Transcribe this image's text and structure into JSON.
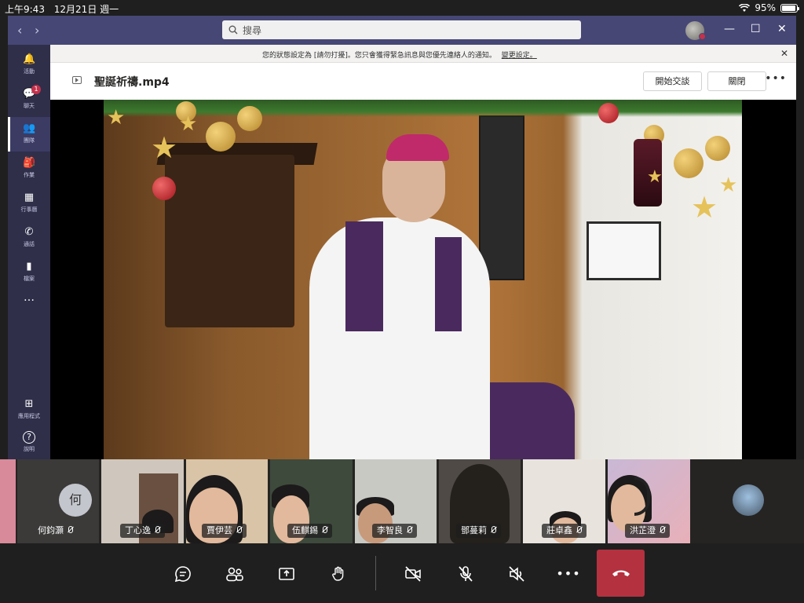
{
  "status_bar": {
    "time": "上午9:43",
    "date": "12月21日 週一",
    "battery": "95%",
    "battery_level": 0.95
  },
  "titlebar": {
    "search_placeholder": "搜尋",
    "back": "‹",
    "forward": "›",
    "minimize": "—",
    "maximize": "☐",
    "close": "✕"
  },
  "rail": {
    "items": [
      {
        "label": "活動",
        "icon": "bell-icon",
        "glyph": "🔔"
      },
      {
        "label": "聊天",
        "icon": "chat-icon",
        "glyph": "💬",
        "badge": "1"
      },
      {
        "label": "團隊",
        "icon": "teams-icon",
        "glyph": "👥",
        "active": true
      },
      {
        "label": "作業",
        "icon": "assignments-icon",
        "glyph": "🎒"
      },
      {
        "label": "行事曆",
        "icon": "calendar-icon",
        "glyph": "▦"
      },
      {
        "label": "通話",
        "icon": "phone-icon",
        "glyph": "✆"
      },
      {
        "label": "檔案",
        "icon": "file-icon",
        "glyph": "▮"
      },
      {
        "label": "…",
        "icon": "more-icon"
      }
    ],
    "bottom": [
      {
        "label": "應用程式",
        "icon": "apps-icon",
        "glyph": "⊞"
      },
      {
        "label": "說明",
        "icon": "help-icon",
        "glyph": "?"
      }
    ]
  },
  "notice": {
    "text": "您的狀態設定為 [請勿打擾]。您只會獲得緊急訊息與您優先連絡人的通知。",
    "link": "變更設定。",
    "close": "✕"
  },
  "file": {
    "name": "聖誕祈禱.mp4",
    "start_chat": "開始交談",
    "close": "關閉",
    "more": "•••"
  },
  "participants": [
    {
      "name": "何鈞灝",
      "initial": "何"
    },
    {
      "name": "丁心逸"
    },
    {
      "name": "賈伊芸"
    },
    {
      "name": "伍麒錫"
    },
    {
      "name": "李智良"
    },
    {
      "name": "鄧蔓莉"
    },
    {
      "name": "莊卓鑫"
    },
    {
      "name": "洪芷澄"
    }
  ],
  "controls": {
    "chat": "chat-icon",
    "people": "people-icon",
    "share": "share-screen-icon",
    "raise_hand": "raise-hand-icon",
    "camera_off": "camera-off-icon",
    "mic_off": "mic-off-icon",
    "speaker_off": "speaker-off-icon",
    "more": "•••",
    "hangup": "hang-up-icon"
  },
  "colors": {
    "titlebar": "#464775",
    "rail": "#2f2f4a",
    "hangup": "#b4313f",
    "badge": "#c4314b"
  }
}
